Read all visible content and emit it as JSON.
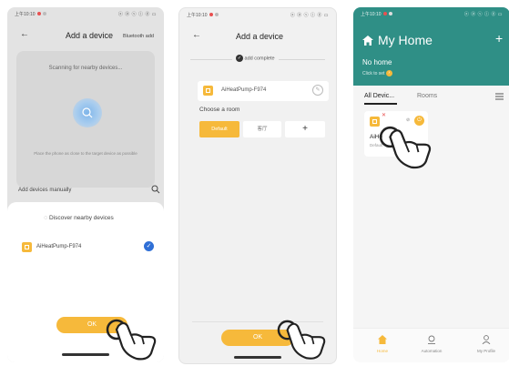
{
  "screen1": {
    "status_time": "上午10:10",
    "status_right": "ⓧ ⓟ ⓢ ⓘ ⓖ ▭",
    "title": "Add a device",
    "bluetooth_link": "Bluetooth add",
    "scanning_text": "Scanning for nearby devices...",
    "hint_text": "Place the phone as close to the target device as possible",
    "add_manually": "Add devices manually",
    "sheet_title": "Discover nearby devices",
    "device_name": "AiHeatPump-F974",
    "ok_label": "OK"
  },
  "screen2": {
    "status_time": "上午10:10",
    "status_right": "ⓧ ⓟ ⓢ ⓘ ⓖ ▭",
    "title": "Add a device",
    "complete_text": "add complete",
    "device_name": "AiHeatPump-F974",
    "choose_room": "Choose a room",
    "room_default": "Default",
    "room_other": "客厅",
    "add_symbol": "+",
    "ok_label": "OK"
  },
  "screen3": {
    "status_time": "上午10:10",
    "status_right": "ⓧ ⓟ ⓢ ⓘ ⓖ ▭",
    "title": "My Home",
    "plus": "+",
    "no_home": "No home",
    "click_to_set": "Click to set",
    "tab_all": "All Devic...",
    "tab_rooms": "Rooms",
    "device_short": "AiHe",
    "device_room": "Default",
    "nav_home": "Home",
    "nav_automation": "Automation",
    "nav_profile": "My Profile"
  },
  "colors": {
    "accent": "#f6b93b",
    "teal": "#2f8f86",
    "blue": "#2f6fd6"
  }
}
